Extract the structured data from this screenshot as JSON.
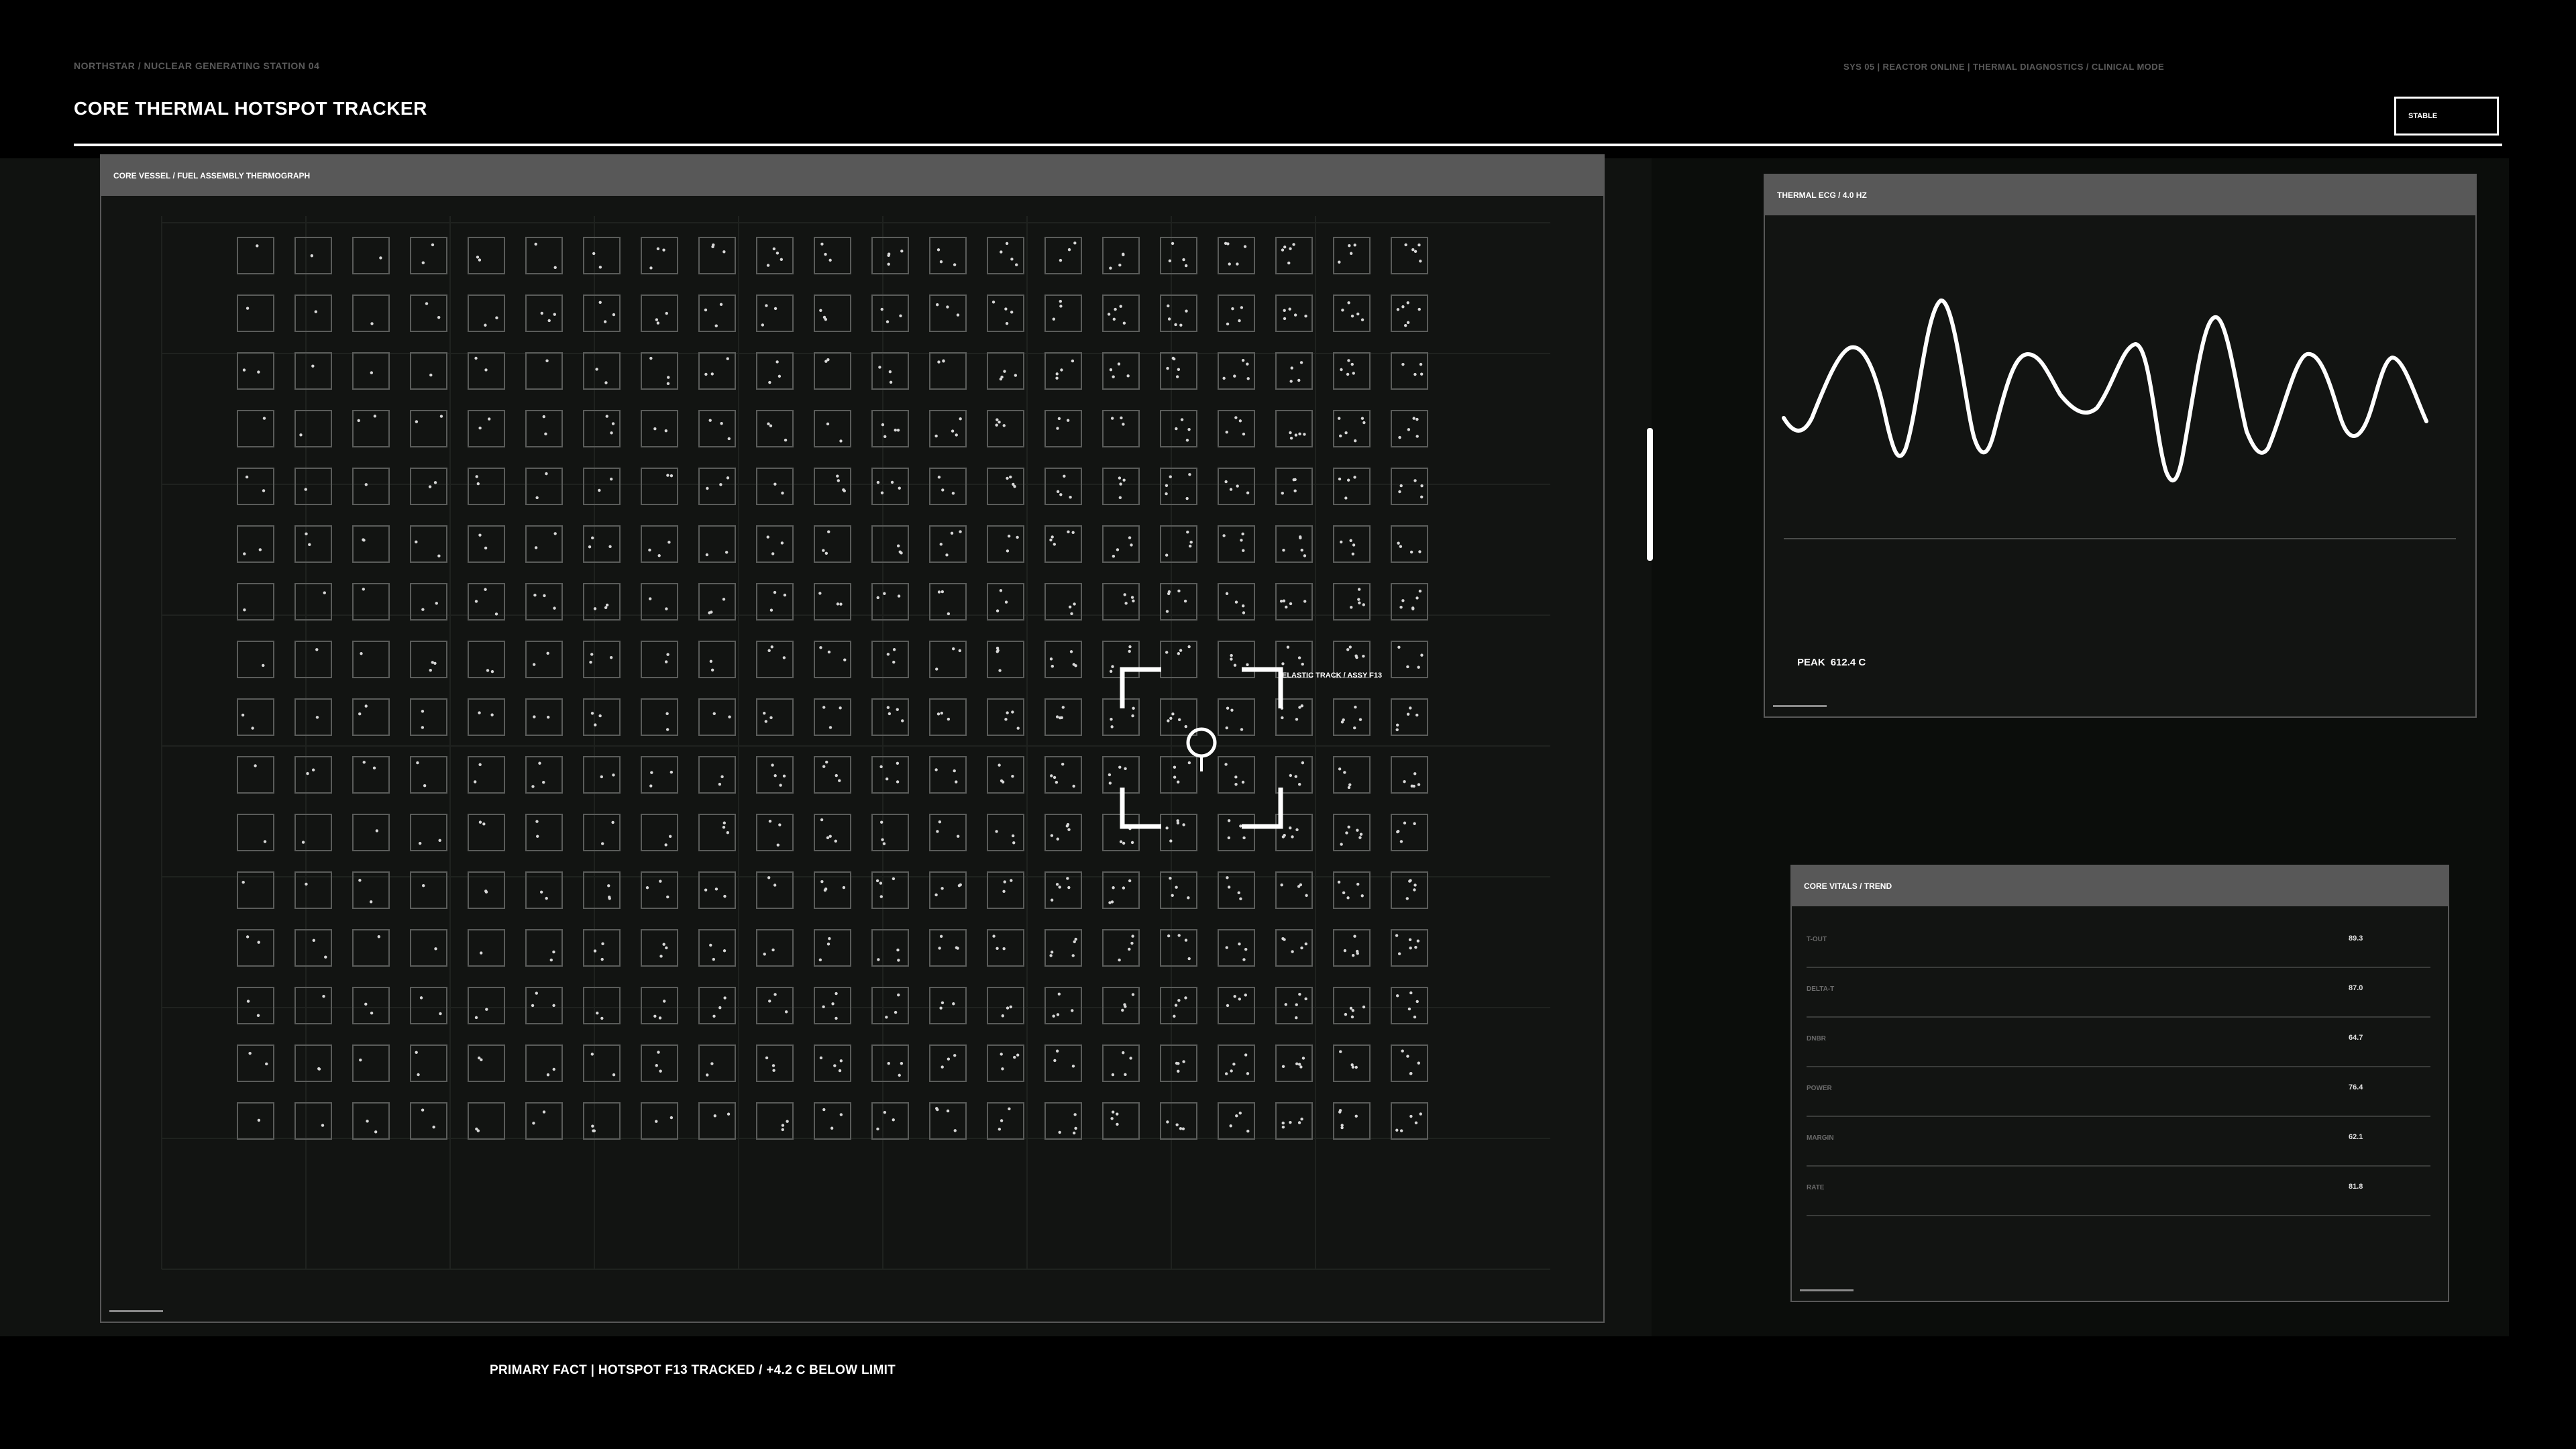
{
  "header": {
    "breadcrumb": "NORTHSTAR / NUCLEAR GENERATING STATION 04",
    "title": "CORE THERMAL HOTSPOT TRACKER",
    "system_line": "SYS 05 | REACTOR ONLINE | THERMAL DIAGNOSTICS / CLINICAL MODE",
    "status_label": "STABLE"
  },
  "thermograph": {
    "title": "CORE VESSEL / FUEL ASSEMBLY THERMOGRAPH",
    "grid_rows": 16,
    "grid_cols": 21,
    "tracker_label": "ELASTIC TRACK / ASSY F13"
  },
  "ecg": {
    "title": "THERMAL ECG / 4.0 HZ",
    "peak_label": "PEAK",
    "peak_value": "612.4 C"
  },
  "vitals": {
    "title": "CORE VITALS / TREND",
    "rows": [
      {
        "label": "T-OUT",
        "value": "89.3"
      },
      {
        "label": "DELTA-T",
        "value": "87.0"
      },
      {
        "label": "DNBR",
        "value": "64.7"
      },
      {
        "label": "POWER",
        "value": "76.4"
      },
      {
        "label": "MARGIN",
        "value": "62.1"
      },
      {
        "label": "RATE",
        "value": "81.8"
      }
    ]
  },
  "footer": {
    "primary_fact": "PRIMARY FACT | HOTSPOT F13 TRACKED / +4.2 C BELOW LIMIT"
  },
  "colors": {
    "background": "#000000",
    "panel": "#121412",
    "panel_header": "#585858",
    "accent": "#ffffff",
    "muted_text": "#5a5a5a"
  }
}
